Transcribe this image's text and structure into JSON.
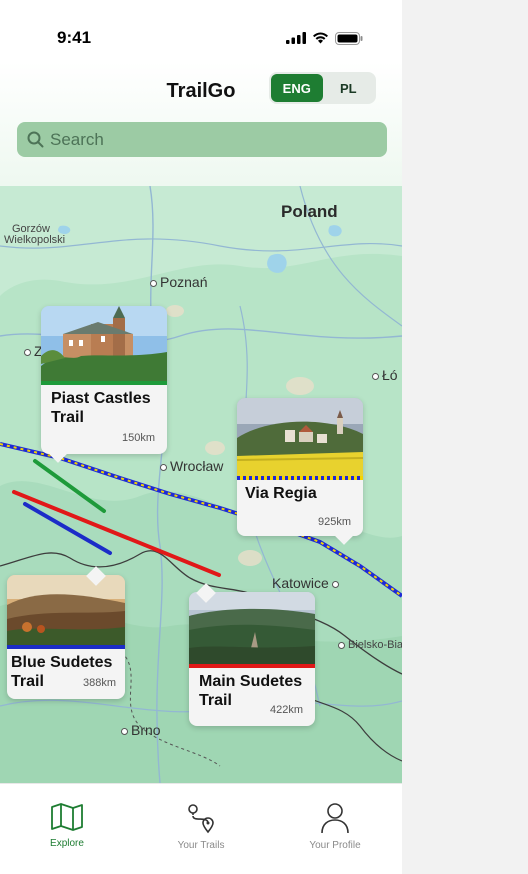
{
  "status_bar": {
    "time": "9:41"
  },
  "header": {
    "title": "TrailGo"
  },
  "language": {
    "options": [
      "ENG",
      "PL"
    ],
    "selected": "ENG"
  },
  "search": {
    "placeholder": "Search",
    "value": ""
  },
  "map": {
    "country": "Poland",
    "cities": {
      "gorzow_line1": "Gorzów",
      "gorzow_line2": "Wielkopolski",
      "poznan": "Poznań",
      "wroclaw": "Wrocław",
      "katowice": "Katowice",
      "bielsko": "Bielsko-Bia",
      "brno": "Brno",
      "lodz": "Łó",
      "z_partial": "Z"
    }
  },
  "trails": [
    {
      "name": "Piast Castles Trail",
      "distance": "150km",
      "color": "#1e9a3a"
    },
    {
      "name": "Via Regia",
      "distance": "925km",
      "color": "#1f2ad6"
    },
    {
      "name": "Blue Sudetes Trail",
      "distance": "388km",
      "color": "#1c2cc8"
    },
    {
      "name": "Main Sudetes Trail",
      "distance": "422km",
      "color": "#e11818"
    }
  ],
  "tabs": [
    {
      "label": "Explore",
      "icon": "map-icon",
      "active": true
    },
    {
      "label": "Your Trails",
      "icon": "route-pins-icon",
      "active": false
    },
    {
      "label": "Your Profile",
      "icon": "person-icon",
      "active": false
    }
  ],
  "colors": {
    "accent": "#1e7d32",
    "search_bg": "#9ccba4",
    "map_bg": "#b7e4c7"
  }
}
